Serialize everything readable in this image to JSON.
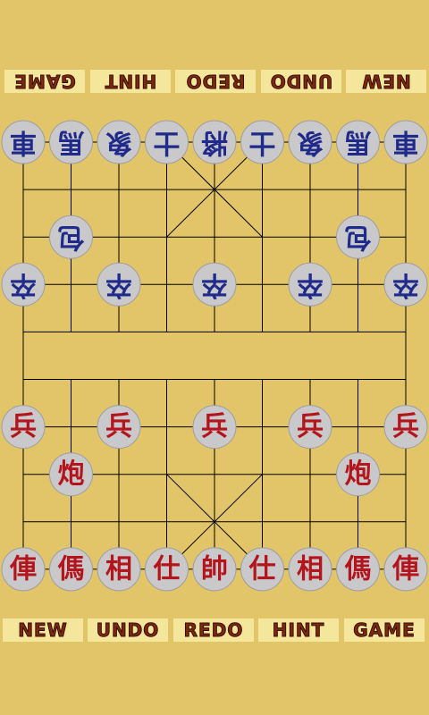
{
  "top_toolbar": {
    "rotated": true,
    "buttons": [
      {
        "id": "new",
        "label": "NEW"
      },
      {
        "id": "undo",
        "label": "UNDO"
      },
      {
        "id": "redo",
        "label": "REDO"
      },
      {
        "id": "hint",
        "label": "HINT"
      },
      {
        "id": "game",
        "label": "GAME"
      }
    ]
  },
  "bottom_toolbar": {
    "buttons": [
      {
        "id": "new",
        "label": "NEW"
      },
      {
        "id": "undo",
        "label": "UNDO"
      },
      {
        "id": "redo",
        "label": "REDO"
      },
      {
        "id": "hint",
        "label": "HINT"
      },
      {
        "id": "game",
        "label": "GAME"
      }
    ]
  },
  "colors": {
    "background": "#E2C469",
    "button_bg": "#F4E79B",
    "button_text": "#7A2A10",
    "board_line": "#000000",
    "piece_fill": "#C9C9CC",
    "blue_side": "#1F2A8A",
    "red_side": "#B4141C"
  },
  "board": {
    "files": 9,
    "ranks": 10,
    "pieces": [
      {
        "side": "blue",
        "name": "rook",
        "glyph": "車",
        "file": 0,
        "rank": 0
      },
      {
        "side": "blue",
        "name": "horse",
        "glyph": "馬",
        "file": 1,
        "rank": 0
      },
      {
        "side": "blue",
        "name": "elephant",
        "glyph": "象",
        "file": 2,
        "rank": 0
      },
      {
        "side": "blue",
        "name": "advisor",
        "glyph": "士",
        "file": 3,
        "rank": 0
      },
      {
        "side": "blue",
        "name": "general",
        "glyph": "將",
        "file": 4,
        "rank": 0
      },
      {
        "side": "blue",
        "name": "advisor",
        "glyph": "士",
        "file": 5,
        "rank": 0
      },
      {
        "side": "blue",
        "name": "elephant",
        "glyph": "象",
        "file": 6,
        "rank": 0
      },
      {
        "side": "blue",
        "name": "horse",
        "glyph": "馬",
        "file": 7,
        "rank": 0
      },
      {
        "side": "blue",
        "name": "rook",
        "glyph": "車",
        "file": 8,
        "rank": 0
      },
      {
        "side": "blue",
        "name": "cannon",
        "glyph": "包",
        "file": 1,
        "rank": 2
      },
      {
        "side": "blue",
        "name": "cannon",
        "glyph": "包",
        "file": 7,
        "rank": 2
      },
      {
        "side": "blue",
        "name": "soldier",
        "glyph": "卒",
        "file": 0,
        "rank": 3
      },
      {
        "side": "blue",
        "name": "soldier",
        "glyph": "卒",
        "file": 2,
        "rank": 3
      },
      {
        "side": "blue",
        "name": "soldier",
        "glyph": "卒",
        "file": 4,
        "rank": 3
      },
      {
        "side": "blue",
        "name": "soldier",
        "glyph": "卒",
        "file": 6,
        "rank": 3
      },
      {
        "side": "blue",
        "name": "soldier",
        "glyph": "卒",
        "file": 8,
        "rank": 3
      },
      {
        "side": "red",
        "name": "soldier",
        "glyph": "兵",
        "file": 0,
        "rank": 6
      },
      {
        "side": "red",
        "name": "soldier",
        "glyph": "兵",
        "file": 2,
        "rank": 6
      },
      {
        "side": "red",
        "name": "soldier",
        "glyph": "兵",
        "file": 4,
        "rank": 6
      },
      {
        "side": "red",
        "name": "soldier",
        "glyph": "兵",
        "file": 6,
        "rank": 6
      },
      {
        "side": "red",
        "name": "soldier",
        "glyph": "兵",
        "file": 8,
        "rank": 6
      },
      {
        "side": "red",
        "name": "cannon",
        "glyph": "炮",
        "file": 1,
        "rank": 7
      },
      {
        "side": "red",
        "name": "cannon",
        "glyph": "炮",
        "file": 7,
        "rank": 7
      },
      {
        "side": "red",
        "name": "chariot",
        "glyph": "俥",
        "file": 0,
        "rank": 9
      },
      {
        "side": "red",
        "name": "horse",
        "glyph": "傌",
        "file": 1,
        "rank": 9
      },
      {
        "side": "red",
        "name": "elephant",
        "glyph": "相",
        "file": 2,
        "rank": 9
      },
      {
        "side": "red",
        "name": "advisor",
        "glyph": "仕",
        "file": 3,
        "rank": 9
      },
      {
        "side": "red",
        "name": "general",
        "glyph": "帥",
        "file": 4,
        "rank": 9
      },
      {
        "side": "red",
        "name": "advisor",
        "glyph": "仕",
        "file": 5,
        "rank": 9
      },
      {
        "side": "red",
        "name": "elephant",
        "glyph": "相",
        "file": 6,
        "rank": 9
      },
      {
        "side": "red",
        "name": "horse",
        "glyph": "傌",
        "file": 7,
        "rank": 9
      },
      {
        "side": "red",
        "name": "chariot",
        "glyph": "俥",
        "file": 8,
        "rank": 9
      }
    ]
  }
}
